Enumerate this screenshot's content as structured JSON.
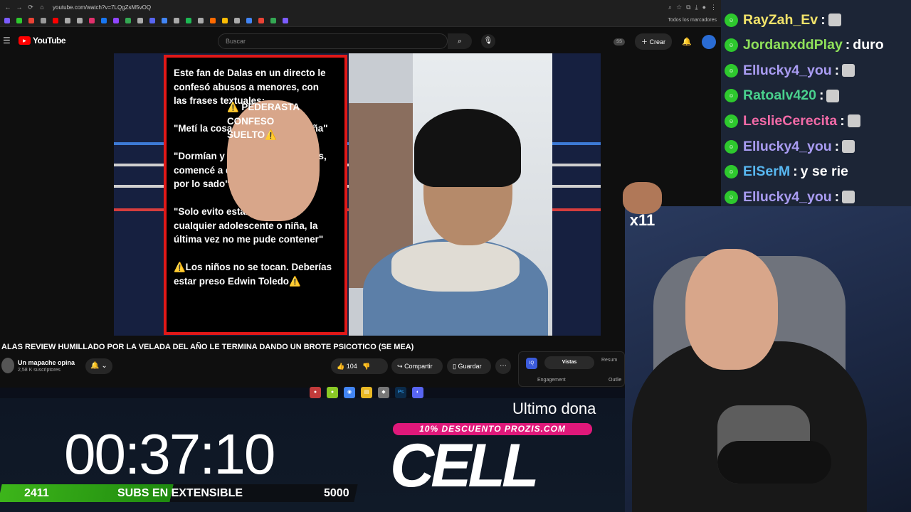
{
  "browser": {
    "url": "youtube.com/watch?v=7LQgZsM5vOQ",
    "bookmarks_all": "Todos los marcadores"
  },
  "youtube": {
    "logo": "YouTube",
    "search_placeholder": "Buscar",
    "ss_badge": "SS",
    "create_label": "Crear",
    "card": {
      "heading": "⚠️ PEDERASTA CONFESO\nSUELTO⚠️",
      "p1": "Este fan de Dalas en un directo le\nconfesó abusos a menores, con\nlas frases textuales:",
      "p2": "\"Metí la cosa en más de una niña\"",
      "p3": "\"Dormían y fue hasta los 16 años,\ncomencé a desarrollar un gusto\npor lo sado\"",
      "p4": "\"Solo evito estar cerca de\ncualquier adolescente o niña, la\núltima vez no me pude contener\"",
      "p5": "⚠️Los niños no se tocan. Deberías\nestar preso Edwin Toledo⚠️"
    },
    "video_title": "ALAS REVIEW HUMILLADO POR LA VELADA DEL AÑO LE TERMINA DANDO UN BROTE PSICOTICO (SE MEA)",
    "channel_name": "Un mapache opina",
    "channel_subs": "2,58 K suscriptores",
    "like_count": "104",
    "share_label": "Compartir",
    "save_label": "Guardar",
    "ext": {
      "tab_active": "Vistas",
      "tab_other": "Resum",
      "engagement": "Engagement",
      "outlier": "Outlie"
    }
  },
  "overlay": {
    "timer": "00:37:10",
    "subs_count": "2411",
    "subs_label": "SUBS EN EXTENSIBLE",
    "subs_goal": "5000",
    "subs_progress": 0.482,
    "ultimo": "Ultimo dona",
    "promo": "10% DESCUENTO PROZIS.COM",
    "brand": "CELL"
  },
  "chat": [
    {
      "user": "RayZah_Ev",
      "color": "#f2e36a",
      "text": "",
      "emote": true
    },
    {
      "user": "JordanxddPlay",
      "color": "#8fe05a",
      "text": "duro",
      "emote": false
    },
    {
      "user": "Ellucky4_you",
      "color": "#a99cf2",
      "text": "",
      "emote": true
    },
    {
      "user": "Ratoalv420",
      "color": "#49d18d",
      "text": "",
      "emote": true
    },
    {
      "user": "LeslieCerecita",
      "color": "#f26aa7",
      "text": "",
      "emote": true
    },
    {
      "user": "Ellucky4_you",
      "color": "#a99cf2",
      "text": "",
      "emote": true
    },
    {
      "user": "ElSerM",
      "color": "#58b8f2",
      "text": "y se rie",
      "emote": false
    },
    {
      "user": "Ellucky4_you",
      "color": "#a99cf2",
      "text": "",
      "emote": true
    }
  ],
  "emote_combo": "x11"
}
